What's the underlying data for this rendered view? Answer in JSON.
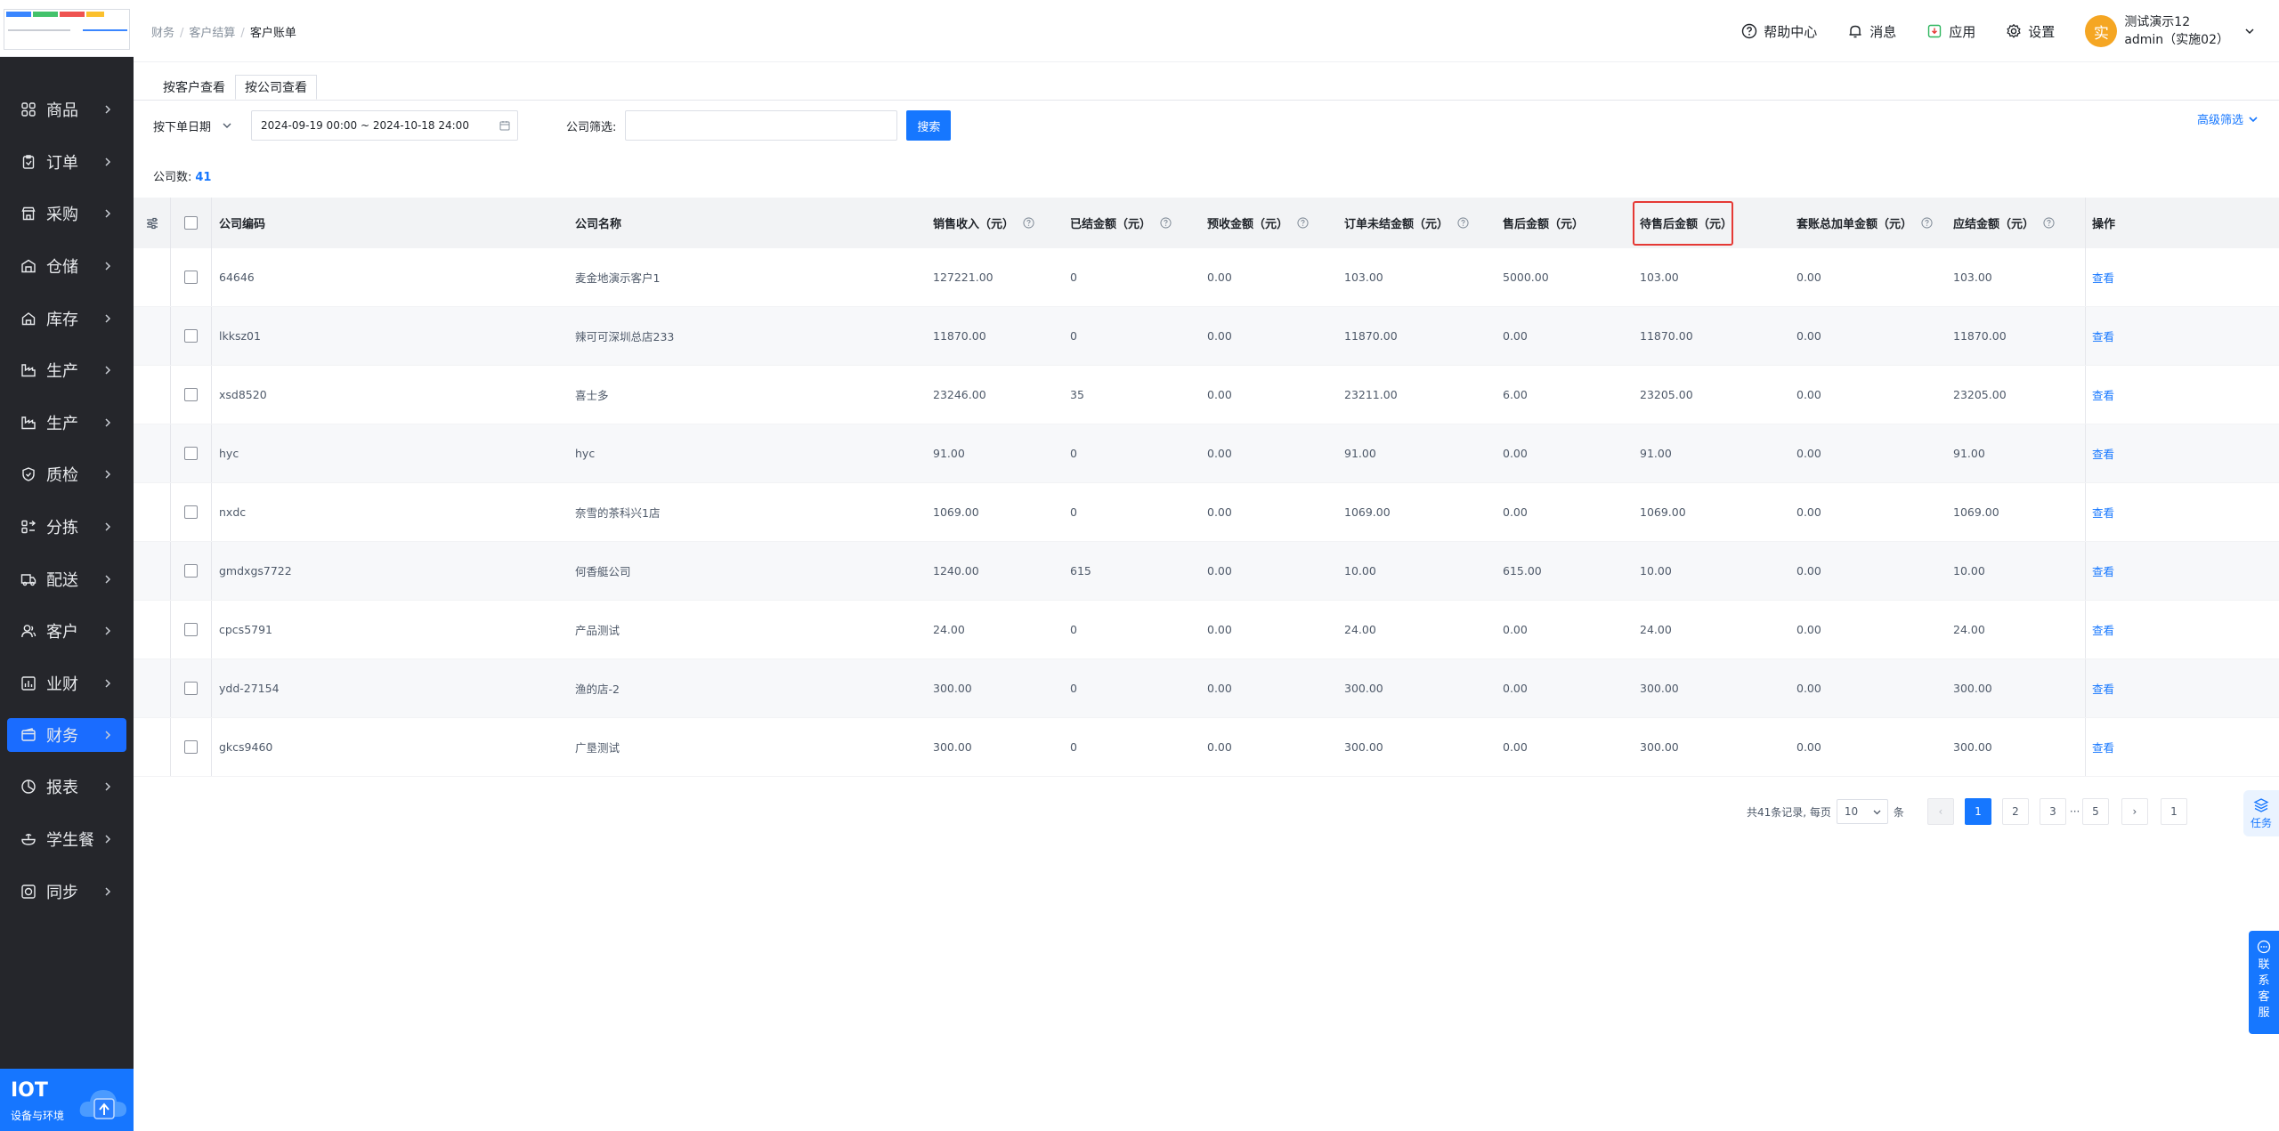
{
  "sidebar": {
    "items": [
      {
        "label": "商品",
        "icon": "grid-icon"
      },
      {
        "label": "订单",
        "icon": "clipboard-icon"
      },
      {
        "label": "采购",
        "icon": "shop-icon"
      },
      {
        "label": "仓储",
        "icon": "warehouse-icon"
      },
      {
        "label": "库存",
        "icon": "home-box-icon"
      },
      {
        "label": "生产",
        "icon": "factory-icon"
      },
      {
        "label": "生产",
        "icon": "factory-icon"
      },
      {
        "label": "质检",
        "icon": "shield-icon"
      },
      {
        "label": "分拣",
        "icon": "sort-icon"
      },
      {
        "label": "配送",
        "icon": "truck-icon"
      },
      {
        "label": "客户",
        "icon": "user-icon"
      },
      {
        "label": "业财",
        "icon": "chart-icon"
      },
      {
        "label": "财务",
        "icon": "wallet-icon",
        "active": true
      },
      {
        "label": "报表",
        "icon": "pie-icon"
      },
      {
        "label": "学生餐",
        "icon": "bowl-icon"
      },
      {
        "label": "同步",
        "icon": "sync-icon"
      }
    ],
    "iot": {
      "title": "IOT",
      "subtitle": "设备与环境"
    }
  },
  "header": {
    "breadcrumb": [
      "财务",
      "客户结算",
      "客户账单"
    ],
    "help": "帮助中心",
    "messages": "消息",
    "apps": "应用",
    "settings": "设置",
    "user": {
      "avatar": "实",
      "name": "测试演示12",
      "account": "admin（实施02）"
    }
  },
  "tabs": [
    {
      "label": "按客户查看",
      "active": false
    },
    {
      "label": "按公司查看",
      "active": true
    }
  ],
  "filter": {
    "date_type": "按下单日期",
    "date_range": "2024-09-19 00:00 ~ 2024-10-18 24:00",
    "company_label": "公司筛选:",
    "company_placeholder": "",
    "search_label": "搜索",
    "advanced_label": "高级筛选"
  },
  "summary": {
    "label": "公司数:",
    "count": "41"
  },
  "table": {
    "columns": [
      "公司编码",
      "公司名称",
      "销售收入（元）",
      "已结金额（元）",
      "预收金额（元）",
      "订单未结金额（元）",
      "售后金额（元）",
      "待售后金额（元）",
      "套账总加单金额（元）",
      "应结金额（元）",
      "操作"
    ],
    "rows": [
      [
        "64646",
        "麦金地演示客户1",
        "127221.00",
        "0",
        "0.00",
        "103.00",
        "5000.00",
        "103.00",
        "0.00",
        "103.00"
      ],
      [
        "lkksz01",
        "辣可可深圳总店233",
        "11870.00",
        "0",
        "0.00",
        "11870.00",
        "0.00",
        "11870.00",
        "0.00",
        "11870.00"
      ],
      [
        "xsd8520",
        "喜士多",
        "23246.00",
        "35",
        "0.00",
        "23211.00",
        "6.00",
        "23205.00",
        "0.00",
        "23205.00"
      ],
      [
        "hyc",
        "hyc",
        "91.00",
        "0",
        "0.00",
        "91.00",
        "0.00",
        "91.00",
        "0.00",
        "91.00"
      ],
      [
        "nxdc",
        "奈雪的茶科兴1店",
        "1069.00",
        "0",
        "0.00",
        "1069.00",
        "0.00",
        "1069.00",
        "0.00",
        "1069.00"
      ],
      [
        "gmdxgs7722",
        "何香艇公司",
        "1240.00",
        "615",
        "0.00",
        "10.00",
        "615.00",
        "10.00",
        "0.00",
        "10.00"
      ],
      [
        "cpcs5791",
        "产品测试",
        "24.00",
        "0",
        "0.00",
        "24.00",
        "0.00",
        "24.00",
        "0.00",
        "24.00"
      ],
      [
        "ydd-27154",
        "渔的店-2",
        "300.00",
        "0",
        "0.00",
        "300.00",
        "0.00",
        "300.00",
        "0.00",
        "300.00"
      ],
      [
        "gkcs9460",
        "广垦测试",
        "300.00",
        "0",
        "0.00",
        "300.00",
        "0.00",
        "300.00",
        "0.00",
        "300.00"
      ]
    ],
    "action_label": "查看"
  },
  "pagination": {
    "total_text": "共41条记录, 每页",
    "page_size": "10",
    "unit": "条",
    "prev": "‹",
    "pages": [
      "1",
      "2",
      "3"
    ],
    "dots": "···",
    "last": "5",
    "next": "›",
    "jump_value": "1"
  },
  "floats": {
    "task": "任务",
    "service": [
      "联",
      "系",
      "客",
      "服"
    ]
  },
  "colors": {
    "accent": "#1677ff",
    "sidebar": "#25262b",
    "highlight": "#e53935"
  }
}
